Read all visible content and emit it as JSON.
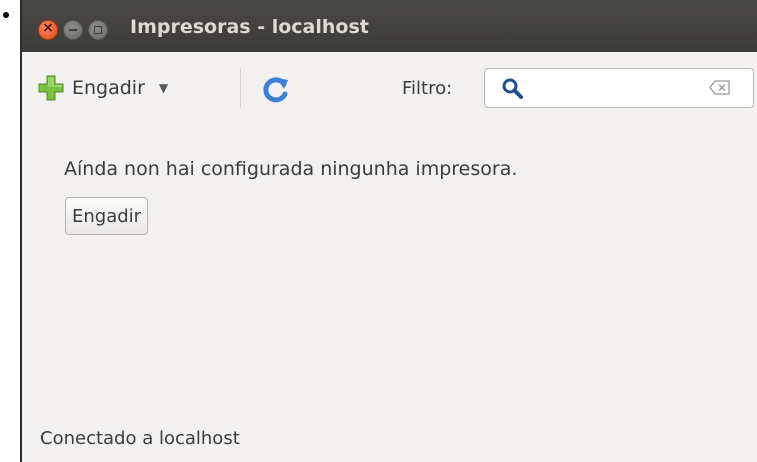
{
  "window": {
    "title": "Impresoras - localhost"
  },
  "toolbar": {
    "add_label": "Engadir",
    "filter_label": "Filtro:",
    "filter_value": ""
  },
  "main": {
    "empty_message": "Aínda non hai configurada ningunha impresora.",
    "add_button_label": "Engadir"
  },
  "status": {
    "text": "Conectado a localhost"
  },
  "icons": {
    "add": "plus-icon",
    "refresh": "refresh-icon",
    "search": "search-icon",
    "clear": "clear-icon"
  },
  "colors": {
    "titlebar": "#3c3b37",
    "close_button": "#df4a16",
    "window_bg": "#f2f1f0",
    "plus_green": "#7cc242",
    "refresh_blue": "#3e7ed6"
  }
}
